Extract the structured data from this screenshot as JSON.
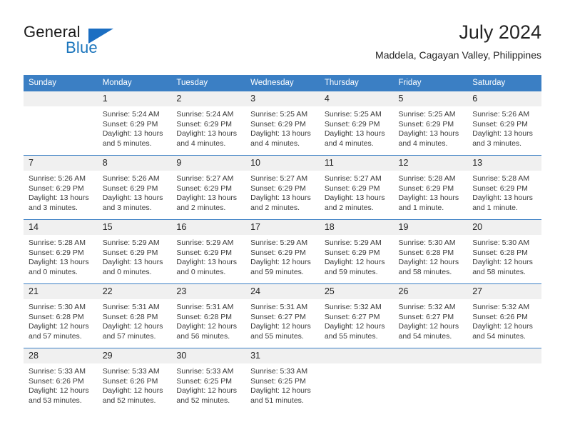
{
  "brand": {
    "word_general": "General",
    "word_blue": "Blue",
    "accent_color": "#1b6ec2"
  },
  "header": {
    "month_title": "July 2024",
    "location": "Maddela, Cagayan Valley, Philippines"
  },
  "calendar": {
    "header_bg": "#3b7fc4",
    "daynum_bg": "#f0f0f0",
    "weekdays": [
      "Sunday",
      "Monday",
      "Tuesday",
      "Wednesday",
      "Thursday",
      "Friday",
      "Saturday"
    ],
    "labels": {
      "sunrise": "Sunrise:",
      "sunset": "Sunset:",
      "daylight": "Daylight:"
    },
    "weeks": [
      [
        {
          "day": "",
          "empty": true
        },
        {
          "day": "1",
          "sunrise": "Sunrise: 5:24 AM",
          "sunset": "Sunset: 6:29 PM",
          "daylight_line1": "Daylight: 13 hours",
          "daylight_line2": "and 5 minutes."
        },
        {
          "day": "2",
          "sunrise": "Sunrise: 5:24 AM",
          "sunset": "Sunset: 6:29 PM",
          "daylight_line1": "Daylight: 13 hours",
          "daylight_line2": "and 4 minutes."
        },
        {
          "day": "3",
          "sunrise": "Sunrise: 5:25 AM",
          "sunset": "Sunset: 6:29 PM",
          "daylight_line1": "Daylight: 13 hours",
          "daylight_line2": "and 4 minutes."
        },
        {
          "day": "4",
          "sunrise": "Sunrise: 5:25 AM",
          "sunset": "Sunset: 6:29 PM",
          "daylight_line1": "Daylight: 13 hours",
          "daylight_line2": "and 4 minutes."
        },
        {
          "day": "5",
          "sunrise": "Sunrise: 5:25 AM",
          "sunset": "Sunset: 6:29 PM",
          "daylight_line1": "Daylight: 13 hours",
          "daylight_line2": "and 4 minutes."
        },
        {
          "day": "6",
          "sunrise": "Sunrise: 5:26 AM",
          "sunset": "Sunset: 6:29 PM",
          "daylight_line1": "Daylight: 13 hours",
          "daylight_line2": "and 3 minutes."
        }
      ],
      [
        {
          "day": "7",
          "sunrise": "Sunrise: 5:26 AM",
          "sunset": "Sunset: 6:29 PM",
          "daylight_line1": "Daylight: 13 hours",
          "daylight_line2": "and 3 minutes."
        },
        {
          "day": "8",
          "sunrise": "Sunrise: 5:26 AM",
          "sunset": "Sunset: 6:29 PM",
          "daylight_line1": "Daylight: 13 hours",
          "daylight_line2": "and 3 minutes."
        },
        {
          "day": "9",
          "sunrise": "Sunrise: 5:27 AM",
          "sunset": "Sunset: 6:29 PM",
          "daylight_line1": "Daylight: 13 hours",
          "daylight_line2": "and 2 minutes."
        },
        {
          "day": "10",
          "sunrise": "Sunrise: 5:27 AM",
          "sunset": "Sunset: 6:29 PM",
          "daylight_line1": "Daylight: 13 hours",
          "daylight_line2": "and 2 minutes."
        },
        {
          "day": "11",
          "sunrise": "Sunrise: 5:27 AM",
          "sunset": "Sunset: 6:29 PM",
          "daylight_line1": "Daylight: 13 hours",
          "daylight_line2": "and 2 minutes."
        },
        {
          "day": "12",
          "sunrise": "Sunrise: 5:28 AM",
          "sunset": "Sunset: 6:29 PM",
          "daylight_line1": "Daylight: 13 hours",
          "daylight_line2": "and 1 minute."
        },
        {
          "day": "13",
          "sunrise": "Sunrise: 5:28 AM",
          "sunset": "Sunset: 6:29 PM",
          "daylight_line1": "Daylight: 13 hours",
          "daylight_line2": "and 1 minute."
        }
      ],
      [
        {
          "day": "14",
          "sunrise": "Sunrise: 5:28 AM",
          "sunset": "Sunset: 6:29 PM",
          "daylight_line1": "Daylight: 13 hours",
          "daylight_line2": "and 0 minutes."
        },
        {
          "day": "15",
          "sunrise": "Sunrise: 5:29 AM",
          "sunset": "Sunset: 6:29 PM",
          "daylight_line1": "Daylight: 13 hours",
          "daylight_line2": "and 0 minutes."
        },
        {
          "day": "16",
          "sunrise": "Sunrise: 5:29 AM",
          "sunset": "Sunset: 6:29 PM",
          "daylight_line1": "Daylight: 13 hours",
          "daylight_line2": "and 0 minutes."
        },
        {
          "day": "17",
          "sunrise": "Sunrise: 5:29 AM",
          "sunset": "Sunset: 6:29 PM",
          "daylight_line1": "Daylight: 12 hours",
          "daylight_line2": "and 59 minutes."
        },
        {
          "day": "18",
          "sunrise": "Sunrise: 5:29 AM",
          "sunset": "Sunset: 6:29 PM",
          "daylight_line1": "Daylight: 12 hours",
          "daylight_line2": "and 59 minutes."
        },
        {
          "day": "19",
          "sunrise": "Sunrise: 5:30 AM",
          "sunset": "Sunset: 6:28 PM",
          "daylight_line1": "Daylight: 12 hours",
          "daylight_line2": "and 58 minutes."
        },
        {
          "day": "20",
          "sunrise": "Sunrise: 5:30 AM",
          "sunset": "Sunset: 6:28 PM",
          "daylight_line1": "Daylight: 12 hours",
          "daylight_line2": "and 58 minutes."
        }
      ],
      [
        {
          "day": "21",
          "sunrise": "Sunrise: 5:30 AM",
          "sunset": "Sunset: 6:28 PM",
          "daylight_line1": "Daylight: 12 hours",
          "daylight_line2": "and 57 minutes."
        },
        {
          "day": "22",
          "sunrise": "Sunrise: 5:31 AM",
          "sunset": "Sunset: 6:28 PM",
          "daylight_line1": "Daylight: 12 hours",
          "daylight_line2": "and 57 minutes."
        },
        {
          "day": "23",
          "sunrise": "Sunrise: 5:31 AM",
          "sunset": "Sunset: 6:28 PM",
          "daylight_line1": "Daylight: 12 hours",
          "daylight_line2": "and 56 minutes."
        },
        {
          "day": "24",
          "sunrise": "Sunrise: 5:31 AM",
          "sunset": "Sunset: 6:27 PM",
          "daylight_line1": "Daylight: 12 hours",
          "daylight_line2": "and 55 minutes."
        },
        {
          "day": "25",
          "sunrise": "Sunrise: 5:32 AM",
          "sunset": "Sunset: 6:27 PM",
          "daylight_line1": "Daylight: 12 hours",
          "daylight_line2": "and 55 minutes."
        },
        {
          "day": "26",
          "sunrise": "Sunrise: 5:32 AM",
          "sunset": "Sunset: 6:27 PM",
          "daylight_line1": "Daylight: 12 hours",
          "daylight_line2": "and 54 minutes."
        },
        {
          "day": "27",
          "sunrise": "Sunrise: 5:32 AM",
          "sunset": "Sunset: 6:26 PM",
          "daylight_line1": "Daylight: 12 hours",
          "daylight_line2": "and 54 minutes."
        }
      ],
      [
        {
          "day": "28",
          "sunrise": "Sunrise: 5:33 AM",
          "sunset": "Sunset: 6:26 PM",
          "daylight_line1": "Daylight: 12 hours",
          "daylight_line2": "and 53 minutes."
        },
        {
          "day": "29",
          "sunrise": "Sunrise: 5:33 AM",
          "sunset": "Sunset: 6:26 PM",
          "daylight_line1": "Daylight: 12 hours",
          "daylight_line2": "and 52 minutes."
        },
        {
          "day": "30",
          "sunrise": "Sunrise: 5:33 AM",
          "sunset": "Sunset: 6:25 PM",
          "daylight_line1": "Daylight: 12 hours",
          "daylight_line2": "and 52 minutes."
        },
        {
          "day": "31",
          "sunrise": "Sunrise: 5:33 AM",
          "sunset": "Sunset: 6:25 PM",
          "daylight_line1": "Daylight: 12 hours",
          "daylight_line2": "and 51 minutes."
        },
        {
          "day": "",
          "empty": true
        },
        {
          "day": "",
          "empty": true
        },
        {
          "day": "",
          "empty": true
        }
      ]
    ]
  }
}
